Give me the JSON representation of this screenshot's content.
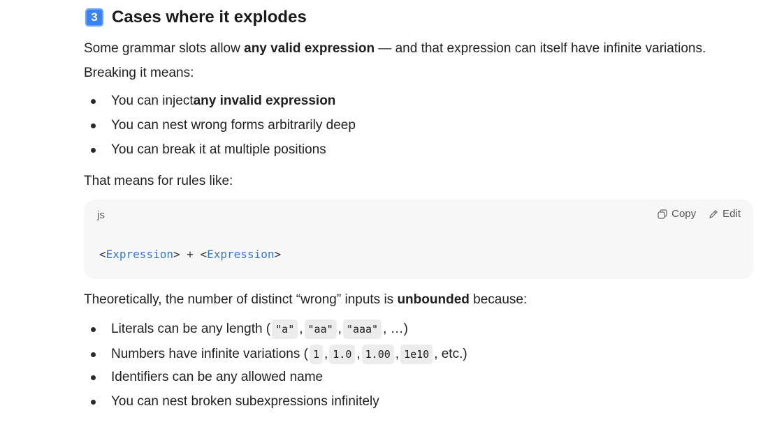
{
  "heading": {
    "badge": "3",
    "title": "Cases where it explodes"
  },
  "intro": {
    "part1": "Some grammar slots allow ",
    "bold": "any valid expression",
    "part2": " — and that expression can itself have infinite variations."
  },
  "breaking": "Breaking it means:",
  "bullets1": [
    {
      "text": "You can inject ",
      "bold": "any invalid expression"
    },
    {
      "text": "You can nest wrong forms arbitrarily deep"
    },
    {
      "text": "You can break it at multiple positions"
    }
  ],
  "rules_intro": "That means for rules like:",
  "code": {
    "lang": "js",
    "copy_label": "Copy",
    "edit_label": "Edit",
    "lt1": "<",
    "type1": "Expression",
    "mid": "> + <",
    "type2": "Expression",
    "gt2": ">"
  },
  "theory": {
    "part1": "Theoretically, the number of distinct “wrong” inputs is ",
    "bold": "unbounded",
    "part2": " because:"
  },
  "bullets2": {
    "literals": {
      "pre": "Literals can be any length (",
      "c1": "\"a\"",
      "c2": "\"aa\"",
      "c3": "\"aaa\"",
      "post": ", …)"
    },
    "numbers": {
      "pre": "Numbers have infinite variations (",
      "c1": "1",
      "c2": "1.0",
      "c3": "1.00",
      "c4": "1e10",
      "post": ", etc.)"
    },
    "identifiers": "Identifiers can be any allowed name",
    "nest": "You can nest broken subexpressions infinitely"
  }
}
